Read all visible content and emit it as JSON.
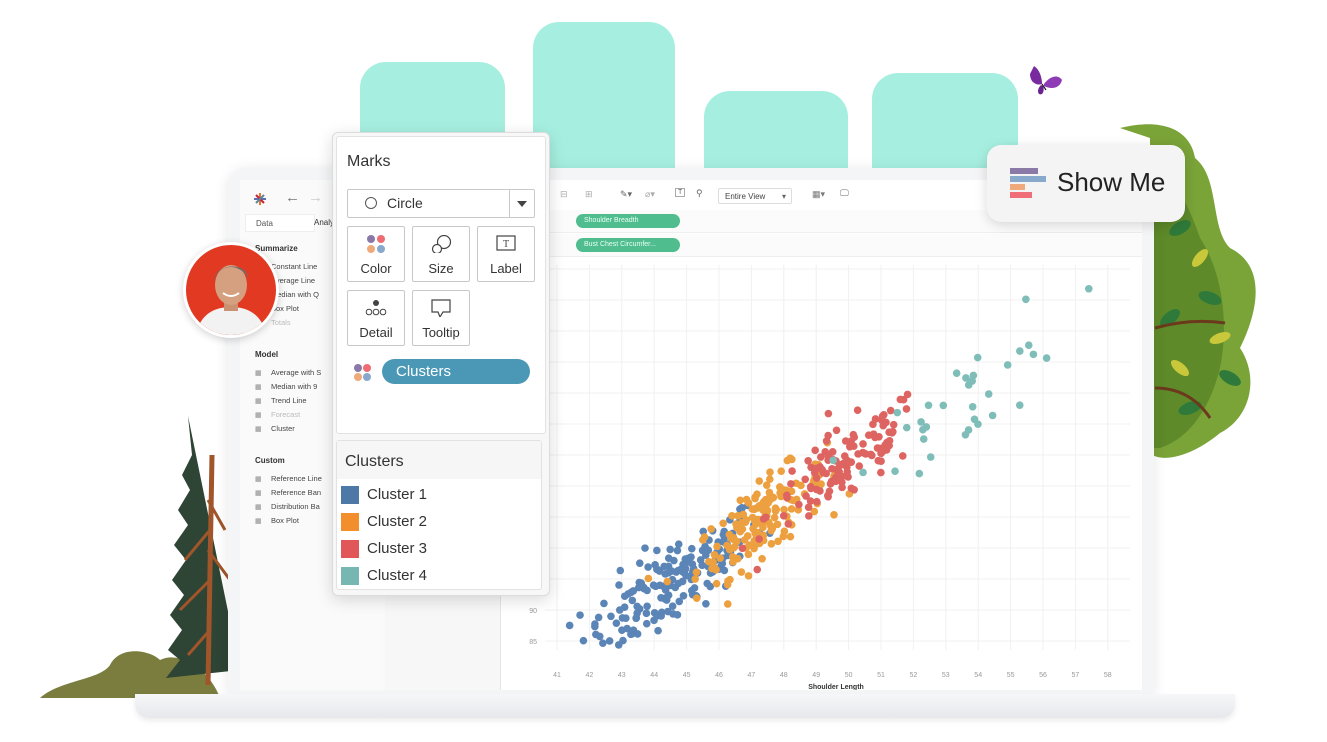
{
  "toolbar": {
    "fit_dropdown": "Entire View",
    "columns_pill": "Shoulder Breadth",
    "rows_pill": "Bust Chest Circumfer..."
  },
  "left_pane": {
    "tabs": [
      "Data",
      "Analytics"
    ],
    "sections": [
      {
        "title": "Summarize",
        "items": [
          {
            "label": "Constant Line",
            "enabled": true
          },
          {
            "label": "Average Line",
            "enabled": true
          },
          {
            "label": "Median with Q",
            "enabled": true
          },
          {
            "label": "Box Plot",
            "enabled": true
          },
          {
            "label": "Totals",
            "enabled": false
          }
        ]
      },
      {
        "title": "Model",
        "items": [
          {
            "label": "Average with S",
            "enabled": true
          },
          {
            "label": "Median with 9",
            "enabled": true
          },
          {
            "label": "Trend Line",
            "enabled": true
          },
          {
            "label": "Forecast",
            "enabled": false
          },
          {
            "label": "Cluster",
            "enabled": true
          }
        ]
      },
      {
        "title": "Custom",
        "items": [
          {
            "label": "Reference Line",
            "enabled": true
          },
          {
            "label": "Reference Ban",
            "enabled": true
          },
          {
            "label": "Distribution Ba",
            "enabled": true
          },
          {
            "label": "Box Plot",
            "enabled": true
          }
        ]
      }
    ]
  },
  "marks_card": {
    "title": "Marks",
    "mark_type": "Circle",
    "buttons": [
      "Color",
      "Size",
      "Label",
      "Detail",
      "Tooltip"
    ],
    "color_field": "Clusters"
  },
  "legend": {
    "title": "Clusters",
    "items": [
      {
        "label": "Cluster 1",
        "color": "#4e79a7"
      },
      {
        "label": "Cluster 2",
        "color": "#f28e2b"
      },
      {
        "label": "Cluster 3",
        "color": "#e15759"
      },
      {
        "label": "Cluster 4",
        "color": "#76b7b2"
      }
    ]
  },
  "show_me": {
    "label": "Show Me",
    "bar_colors": [
      "#8a79a7",
      "#88a8cc",
      "#f0a97a",
      "#f06e78"
    ]
  },
  "chart_data": {
    "type": "scatter",
    "title": "",
    "xlabel": "Shoulder Length",
    "ylabel": "Bust Chest Circumference",
    "x_ticks": [
      41,
      42,
      43,
      44,
      45,
      46,
      47,
      48,
      49,
      50,
      51,
      52,
      53,
      54,
      55,
      56,
      57,
      58
    ],
    "y_ticks": [
      85,
      90
    ],
    "xlim": [
      40.7,
      58.3
    ],
    "ylim": [
      80,
      145
    ],
    "grid": true,
    "series": [
      {
        "name": "Cluster 1",
        "color": "#5b85b6",
        "center": [
          44.6,
          94.5
        ],
        "spread": [
          1.4,
          4.2
        ],
        "count": 170
      },
      {
        "name": "Cluster 2",
        "color": "#eda03f",
        "center": [
          47.3,
          104.5
        ],
        "spread": [
          1.0,
          3.6
        ],
        "count": 160
      },
      {
        "name": "Cluster 3",
        "color": "#de6461",
        "center": [
          49.9,
          113.5
        ],
        "spread": [
          1.2,
          3.8
        ],
        "count": 120
      },
      {
        "name": "Cluster 4",
        "color": "#7fbdb8",
        "center": [
          53.8,
          125.5
        ],
        "spread": [
          1.5,
          5.5
        ],
        "count": 34
      }
    ]
  }
}
